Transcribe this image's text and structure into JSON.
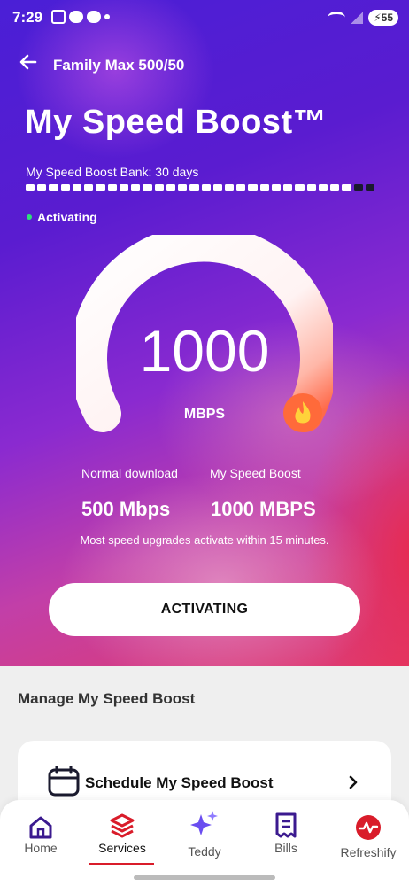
{
  "status_bar": {
    "time": "7:29",
    "battery": "55"
  },
  "header": {
    "plan_name": "Family Max 500/50",
    "title": "My Speed Boost™"
  },
  "bank": {
    "label": "My Speed Boost Bank: 30 days",
    "total_days": 30,
    "remaining_days": 28
  },
  "activation": {
    "status": "Activating",
    "status_color": "#2ee07a"
  },
  "gauge": {
    "value": "1000",
    "unit": "MBPS",
    "icon": "fire-icon"
  },
  "stats": {
    "normal_label": "Normal download",
    "normal_value": "500 Mbps",
    "boost_label": "My Speed Boost",
    "boost_value": "1000 MBPS",
    "note": "Most speed upgrades activate within 15 minutes."
  },
  "cta": {
    "label": "ACTIVATING"
  },
  "manage": {
    "title": "Manage My Speed Boost",
    "schedule_label": "Schedule My Speed Boost"
  },
  "bottom_nav": {
    "items": [
      {
        "label": "Home",
        "icon": "home-icon"
      },
      {
        "label": "Services",
        "icon": "layers-icon",
        "active": true
      },
      {
        "label": "Teddy",
        "icon": "sparkle-icon"
      },
      {
        "label": "Bills",
        "icon": "bill-icon"
      },
      {
        "label": "Refreshify",
        "icon": "refreshify-icon"
      }
    ],
    "active_color": "#d91c2a",
    "icon_color": "#3b1a8f"
  }
}
